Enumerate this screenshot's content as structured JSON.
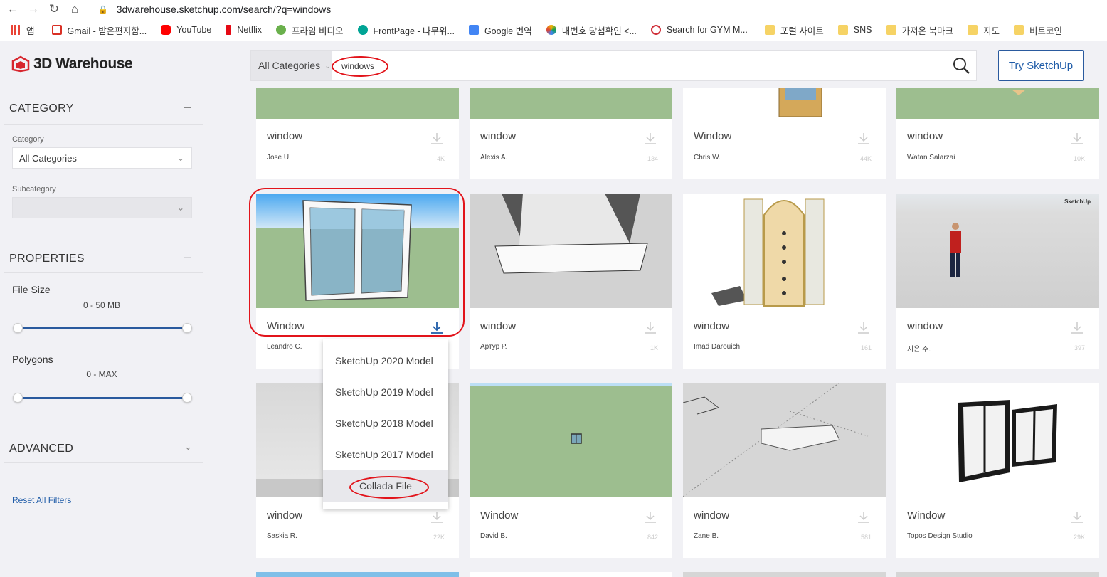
{
  "browser": {
    "url": "3dwarehouse.sketchup.com/search/?q=windows",
    "bookmarks": [
      {
        "label": "앱",
        "color": "#e94335"
      },
      {
        "label": "Gmail - 받은편지함...",
        "color": "#d93025"
      },
      {
        "label": "YouTube",
        "color": "#ff0000"
      },
      {
        "label": "Netflix",
        "color": "#e50914"
      },
      {
        "label": "프라임 비디오",
        "color": "#6ab04c"
      },
      {
        "label": "FrontPage - 나무위...",
        "color": "#00a495"
      },
      {
        "label": "Google 번역",
        "color": "#4285f4"
      },
      {
        "label": "내번호 당첨확인 <...",
        "color": "#f4b400"
      },
      {
        "label": "Search for GYM M...",
        "color": "#d0303a"
      },
      {
        "label": "포털 사이트",
        "color": "#f6d365"
      },
      {
        "label": "SNS",
        "color": "#f6d365"
      },
      {
        "label": "가져온 북마크",
        "color": "#f6d365"
      },
      {
        "label": "지도",
        "color": "#f6d365"
      },
      {
        "label": "비트코인",
        "color": "#f6d365"
      }
    ]
  },
  "header": {
    "logo": "3D Warehouse",
    "category_select": "All Categories",
    "search_value": "windows",
    "try_button": "Try SketchUp"
  },
  "sidebar": {
    "category_heading": "CATEGORY",
    "category_label": "Category",
    "category_value": "All Categories",
    "subcategory_label": "Subcategory",
    "properties_heading": "PROPERTIES",
    "file_size_label": "File Size",
    "file_size_range": "0 - 50 MB",
    "polygons_label": "Polygons",
    "polygons_range": "0 - MAX",
    "advanced_heading": "ADVANCED",
    "reset_link": "Reset All Filters"
  },
  "cards": [
    {
      "title": "window",
      "author": "Jose U.",
      "count": "4K"
    },
    {
      "title": "window",
      "author": "Alexis A.",
      "count": "134"
    },
    {
      "title": "Window",
      "author": "Chris W.",
      "count": "44K"
    },
    {
      "title": "window",
      "author": "Watan Salarzai",
      "count": "10K"
    },
    {
      "title": "Window",
      "author": "Leandro C.",
      "count": ""
    },
    {
      "title": "window",
      "author": "Артур Р.",
      "count": "1K"
    },
    {
      "title": "window",
      "author": "Imad Darouich",
      "count": "161"
    },
    {
      "title": "window",
      "author": "지은 주.",
      "count": "397"
    },
    {
      "title": "window",
      "author": "Saskia R.",
      "count": "22K"
    },
    {
      "title": "Window",
      "author": "David B.",
      "count": "842"
    },
    {
      "title": "window",
      "author": "Zane B.",
      "count": "581"
    },
    {
      "title": "Window",
      "author": "Topos Design Studio",
      "count": "29K"
    }
  ],
  "download_menu": {
    "items": [
      "SketchUp 2020 Model",
      "SketchUp 2019 Model",
      "SketchUp 2018 Model",
      "SketchUp 2017 Model",
      "Collada File"
    ]
  },
  "badge": "SketchUp",
  "colors": {
    "accent": "#1f5ca8",
    "highlight": "#e2141b",
    "grass": "#9dbe8f"
  }
}
